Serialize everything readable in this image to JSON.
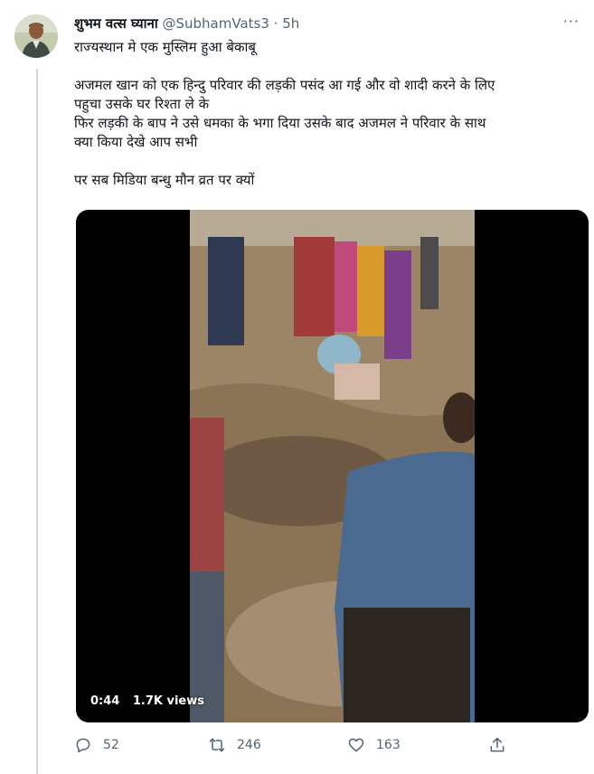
{
  "user": {
    "display_name": "शुभम वत्स घ्याना",
    "handle": "@SubhamVats3",
    "separator": "·",
    "time": "5h",
    "more": "···"
  },
  "tweet": {
    "lines": [
      "राज्यस्थान मे एक मुस्लिम हुआ बेकाबू",
      "",
      "अजमल खान को एक हिन्दु परिवार की लड़की पसंद आ गई और वो शादी करने के लिए",
      "पहुचा उसके घर रिश्ता ले के",
      "फिर लड़की के बाप ने उसे धमका के भगा दिया उसके बाद अजमल ने परिवार के साथ",
      "क्या किया देखे आप सभी",
      "",
      "पर सब मिडिया बन्धु मौन व्रत पर क्यों"
    ]
  },
  "video": {
    "duration": "0:44",
    "views": "1.7K views"
  },
  "actions": {
    "replies": "52",
    "retweets": "246",
    "likes": "163"
  },
  "icons": [
    "reply-icon",
    "retweet-icon",
    "like-icon",
    "share-icon",
    "more-icon"
  ]
}
